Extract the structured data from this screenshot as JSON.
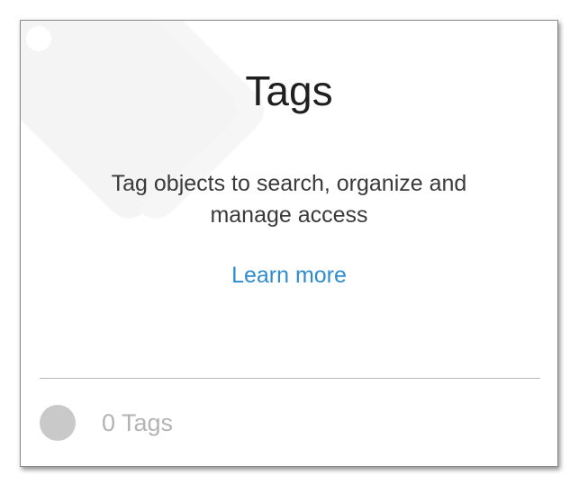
{
  "card": {
    "title": "Tags",
    "description": "Tag objects to search, organize and manage access",
    "learn_more_label": "Learn more",
    "background_icon": "tag-icon"
  },
  "footer": {
    "status_icon": "circle-icon",
    "tag_count_label": "0 Tags"
  },
  "colors": {
    "link": "#2e8ccf",
    "title_text": "#1f1f1f",
    "body_text": "#3a3a3a",
    "muted_text": "#b3b3b3",
    "status_dot": "#c9c9c9"
  }
}
